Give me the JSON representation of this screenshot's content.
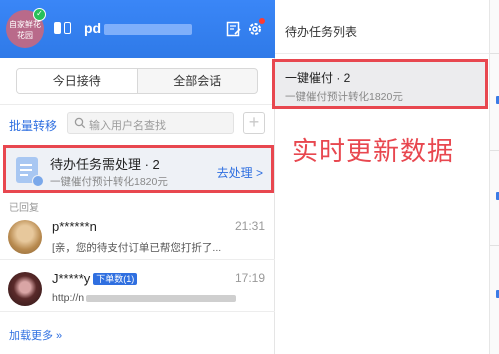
{
  "header": {
    "avatar_text_1": "自家鲜花",
    "avatar_text_2": "花园",
    "username": "pd"
  },
  "tabs": [
    {
      "label": "今日接待",
      "active": true
    },
    {
      "label": "全部会话",
      "active": false
    }
  ],
  "toolbar": {
    "batch_label": "批量转移",
    "search_placeholder": "输入用户名查找"
  },
  "pending": {
    "title": "待办任务需处理 · 2",
    "subtitle": "一键催付预计转化1820元",
    "action": "去处理 >"
  },
  "section_label": "已回复",
  "conversations": [
    {
      "name": "p******n",
      "time": "21:31",
      "message": "[亲，您的待支付订单已帮您打折了..."
    },
    {
      "name": "J*****y",
      "tag": "下单数(1)",
      "time": "17:19",
      "message": "http://n"
    }
  ],
  "load_more": "加载更多 »",
  "right_panel": {
    "title": "待办任务列表",
    "task_title": "一键催付 · 2",
    "task_subtitle": "一键催付预计转化1820元"
  },
  "annotation": "实时更新数据",
  "colors": {
    "accent": "#2f6fe0",
    "header": "#3a86f7",
    "highlight": "#e8474f"
  }
}
